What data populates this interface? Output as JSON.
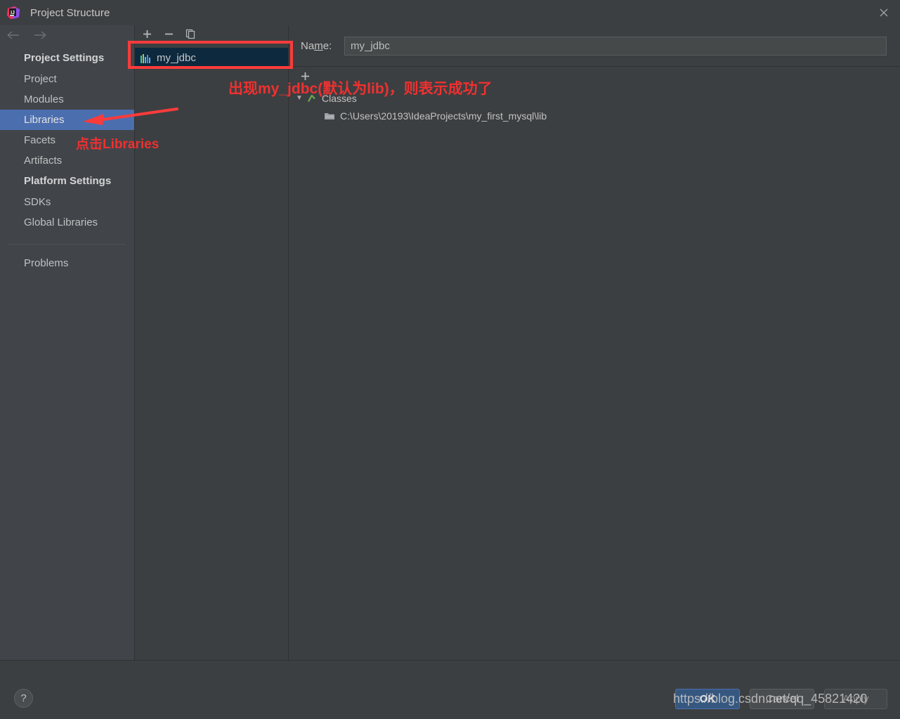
{
  "window": {
    "title": "Project Structure",
    "app_icon": "intellij-idea-logo",
    "close_icon": "close-icon"
  },
  "sidebar": {
    "back_icon": "arrow-left-icon",
    "forward_icon": "arrow-right-icon",
    "groups": [
      {
        "label": "Project Settings",
        "items": [
          {
            "label": "Project",
            "selected": false
          },
          {
            "label": "Modules",
            "selected": false
          },
          {
            "label": "Libraries",
            "selected": true
          },
          {
            "label": "Facets",
            "selected": false
          },
          {
            "label": "Artifacts",
            "selected": false
          }
        ]
      },
      {
        "label": "Platform Settings",
        "items": [
          {
            "label": "SDKs",
            "selected": false
          },
          {
            "label": "Global Libraries",
            "selected": false
          }
        ]
      }
    ],
    "extra": [
      {
        "label": "Problems"
      }
    ]
  },
  "list_panel": {
    "toolbar": [
      {
        "name": "add-button",
        "glyph": "+"
      },
      {
        "name": "remove-button",
        "glyph": "−"
      },
      {
        "name": "copy-button",
        "glyph": "copy-icon"
      }
    ],
    "items": [
      {
        "label": "my_jdbc",
        "icon": "library-icon",
        "selected": true
      }
    ]
  },
  "detail_panel": {
    "name_label_prefix": "Na",
    "name_label_mnemonic": "m",
    "name_label_suffix": "e:",
    "name_value": "my_jdbc",
    "name_placeholder": "",
    "tree_toolbar": [
      {
        "name": "add-classes-button",
        "glyph": "+"
      }
    ],
    "tree": [
      {
        "label": "Classes",
        "icon": "classes-root-icon",
        "expanded": true,
        "twisty": "▼",
        "children": [
          {
            "label": "C:\\Users\\20193\\IdeaProjects\\my_first_mysql\\lib",
            "icon": "archive-folder-icon"
          }
        ]
      }
    ]
  },
  "footer": {
    "help_label": "?",
    "ok_label": "OK",
    "cancel_label": "Cancel",
    "apply_label": "Apply"
  },
  "annotations": {
    "text_top": "出现my_jdbc(默认为lib)，则表示成功了",
    "text_sidebar": "点击Libraries",
    "watermark": "https://blog.csdn.net/qq_45821420",
    "accent_color": "#fb3b3b"
  }
}
